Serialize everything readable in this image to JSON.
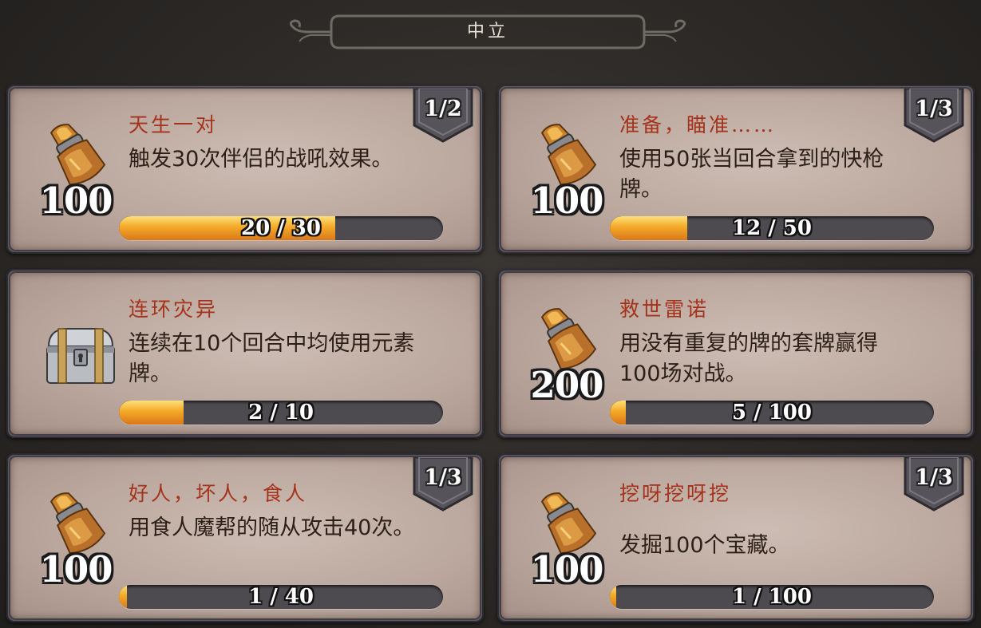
{
  "header": {
    "title": "中立"
  },
  "quests": [
    {
      "title": "天生一对",
      "description": "触发30次伴侣的战吼效果。",
      "reward_type": "gold",
      "reward_amount": "100",
      "badge": "1/2",
      "progress_text": "20 / 30",
      "progress_current": 20,
      "progress_total": 30
    },
    {
      "title": "准备，瞄准……",
      "description": "使用50张当回合拿到的快枪牌。",
      "reward_type": "gold",
      "reward_amount": "100",
      "badge": "1/3",
      "progress_text": "12 / 50",
      "progress_current": 12,
      "progress_total": 50
    },
    {
      "title": "连环灾异",
      "description": "连续在10个回合中均使用元素牌。",
      "reward_type": "chest",
      "reward_amount": "",
      "badge": "",
      "progress_text": "2 / 10",
      "progress_current": 2,
      "progress_total": 10
    },
    {
      "title": "救世雷诺",
      "description": "用没有重复的牌的套牌赢得100场对战。",
      "reward_type": "gold",
      "reward_amount": "200",
      "badge": "",
      "progress_text": "5 / 100",
      "progress_current": 5,
      "progress_total": 100
    },
    {
      "title": "好人，坏人，食人",
      "description": "用食人魔帮的随从攻击40次。",
      "reward_type": "gold",
      "reward_amount": "100",
      "badge": "1/3",
      "progress_text": "1 / 40",
      "progress_current": 1,
      "progress_total": 40
    },
    {
      "title": "挖呀挖呀挖",
      "description": "发掘100个宝藏。",
      "reward_type": "gold",
      "reward_amount": "100",
      "badge": "1/3",
      "progress_text": "1 / 100",
      "progress_current": 1,
      "progress_total": 100
    }
  ],
  "colors": {
    "title": "#a5321b",
    "text": "#2c1f17",
    "progress_fill": "#f4a928"
  },
  "icons": {
    "gold": "gold-pouch-icon",
    "chest": "silver-chest-icon"
  }
}
